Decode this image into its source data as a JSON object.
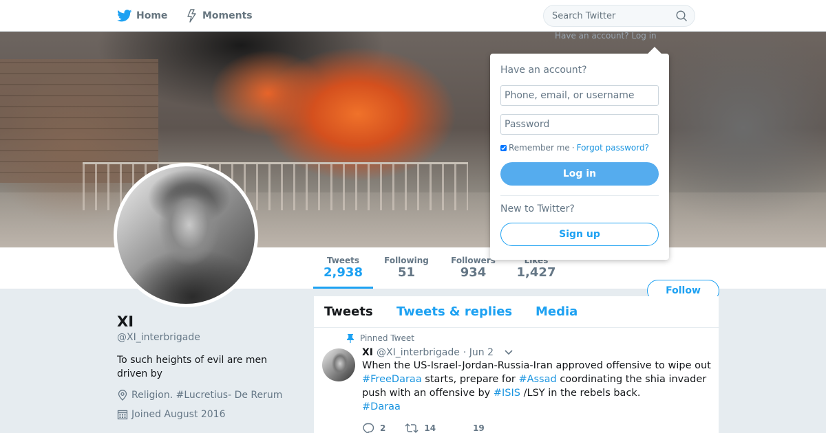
{
  "nav": {
    "home_label": "Home",
    "moments_label": "Moments",
    "search_placeholder": "Search Twitter"
  },
  "login_hint": "Have an account? Log in",
  "profile": {
    "name": "XI",
    "handle": "@XI_interbrigade",
    "bio": "To such heights of evil are men driven by",
    "location": "Religion. #Lucretius- De Rerum",
    "joined": "Joined August 2016",
    "follow_label": "Follow"
  },
  "stats": [
    {
      "label": "Tweets",
      "value": "2,938"
    },
    {
      "label": "Following",
      "value": "51"
    },
    {
      "label": "Followers",
      "value": "934"
    },
    {
      "label": "Likes",
      "value": "1,427"
    }
  ],
  "timeline_tabs": [
    {
      "label": "Tweets"
    },
    {
      "label": "Tweets & replies"
    },
    {
      "label": "Media"
    }
  ],
  "pinned_tweet": {
    "pinned_label": "Pinned Tweet",
    "name": "XI",
    "handle": "@XI_interbrigade",
    "date": "· Jun 2",
    "text": {
      "part1": "When the US-Israel-Jordan-Russia-Iran approved offensive to wipe out ",
      "tag1": "#FreeDaraa",
      "part2": " starts, prepare for ",
      "tag2": "#Assad",
      "part3": " coordinating the shia invader push with an offensive by ",
      "tag3": "#ISIS",
      "part4": " /LSY in the rebels back.",
      "tag4": "#Daraa"
    },
    "replies": "2",
    "retweets": "14",
    "likes": "19"
  },
  "login_dropdown": {
    "title": "Have an account?",
    "username_placeholder": "Phone, email, or username",
    "password_placeholder": "Password",
    "remember_label": "Remember me",
    "separator": "·",
    "forgot_label": "Forgot password?",
    "login_label": "Log in",
    "new_label": "New to Twitter?",
    "signup_label": "Sign up"
  },
  "colors": {
    "brand_blue": "#1da1f2",
    "login_button": "#55acee",
    "hashtag": "#1b95e0",
    "page_bg": "#e6ecf0"
  }
}
